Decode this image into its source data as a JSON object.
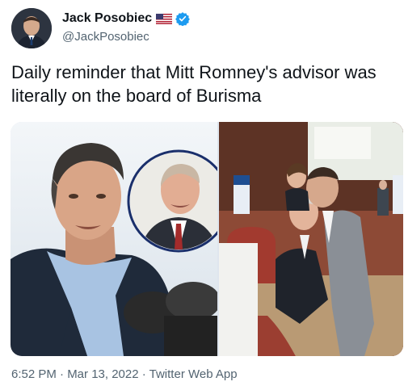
{
  "author": {
    "name": "Jack Posobiec",
    "handle": "@JackPosobiec",
    "flag_icon": "us-flag-icon",
    "verified_icon": "verified-badge-icon"
  },
  "tweet": {
    "text": "Daily reminder that Mitt Romney's advisor was literally on the board of Burisma"
  },
  "meta": {
    "timestamp": "6:52 PM · Mar 13, 2022 · Twitter Web App"
  },
  "colors": {
    "verified": "#1d9bf0",
    "secondary_text": "#536471",
    "primary_text": "#0f1419"
  }
}
